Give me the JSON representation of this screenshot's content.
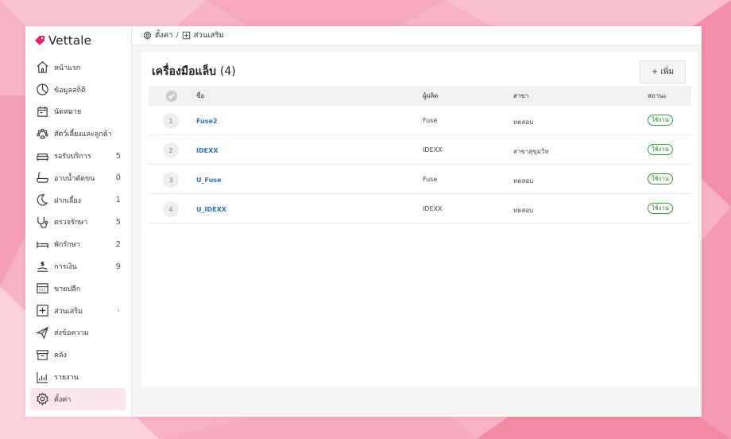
{
  "app": {
    "logo_text": "Vettale",
    "brand_color": "#e8246b",
    "accent_soft": "#fde6ee"
  },
  "breadcrumb": {
    "first": "ตั้งค่า",
    "separator": "/",
    "second": "ส่วนเสริม"
  },
  "sidebar": {
    "items": [
      {
        "label": "หน้าแรก",
        "icon": "home-icon",
        "count": ""
      },
      {
        "label": "ข้อมูลสถิติ",
        "icon": "stats-icon",
        "count": ""
      },
      {
        "label": "นัดหมาย",
        "icon": "calendar-icon",
        "count": ""
      },
      {
        "label": "สัตว์เลี้ยงและลูกค้า",
        "icon": "paw-icon",
        "count": ""
      },
      {
        "label": "รอรับบริการ",
        "icon": "sofa-icon",
        "count": "5"
      },
      {
        "label": "อาบน้ำตัดขน",
        "icon": "bathtub-icon",
        "count": "0"
      },
      {
        "label": "ฝากเลี้ยง",
        "icon": "moon-icon",
        "count": "1"
      },
      {
        "label": "ตรวจรักษา",
        "icon": "stethoscope-icon",
        "count": "5"
      },
      {
        "label": "พักรักษา",
        "icon": "bed-icon",
        "count": "2"
      },
      {
        "label": "การเงิน",
        "icon": "money-icon",
        "count": "9"
      },
      {
        "label": "ขายปลีก",
        "icon": "register-icon",
        "count": ""
      },
      {
        "label": "ส่วนเสริม",
        "icon": "plus-box-icon",
        "count": "",
        "chevron": "›"
      },
      {
        "label": "ส่งข้อความ",
        "icon": "send-icon",
        "count": ""
      },
      {
        "label": "คลัง",
        "icon": "archive-icon",
        "count": ""
      },
      {
        "label": "รายงาน",
        "icon": "bar-chart-icon",
        "count": ""
      },
      {
        "label": "ตั้งค่า",
        "icon": "gear-icon",
        "count": "",
        "active": true
      }
    ]
  },
  "card": {
    "title": "เครื่องมือแล็บ",
    "count_label": "(4)",
    "add_button": "+ เพิ่ม"
  },
  "table": {
    "headers": {
      "name": "ชื่อ",
      "manufacturer": "ผู้ผลิต",
      "branch": "สาขา",
      "status": "สถานะ"
    },
    "rows": [
      {
        "num": "1",
        "name": "Fuse2",
        "manufacturer": "Fuse",
        "branch": "ทดสอบ",
        "status": "ใช้งาน"
      },
      {
        "num": "2",
        "name": "IDEXX",
        "manufacturer": "IDEXX",
        "branch": "สาขาสุขุมวิท",
        "status": "ใช้งาน"
      },
      {
        "num": "3",
        "name": "U_Fuse",
        "manufacturer": "Fuse",
        "branch": "ทดสอบ",
        "status": "ใช้งาน"
      },
      {
        "num": "4",
        "name": "U_IDEXX",
        "manufacturer": "IDEXX",
        "branch": "ทดสอบ",
        "status": "ใช้งาน"
      }
    ]
  }
}
